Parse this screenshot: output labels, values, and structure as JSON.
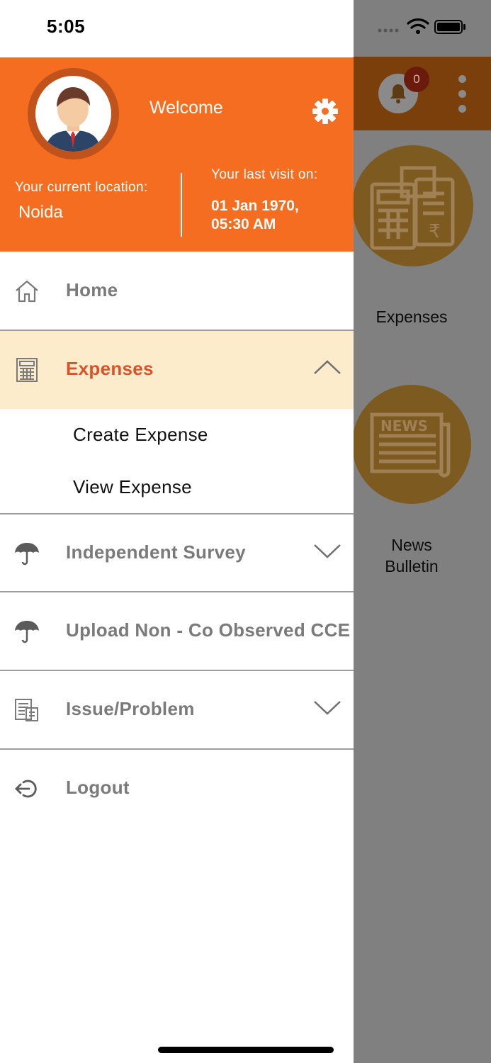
{
  "status_bar": {
    "time": "5:05"
  },
  "background_screen": {
    "notification_count": "0",
    "tiles": [
      {
        "label": "Expenses"
      },
      {
        "label": "News\nBulletin",
        "icon_text": "NEWS"
      }
    ]
  },
  "drawer": {
    "header": {
      "welcome": "Welcome",
      "location_label": "Your current location:",
      "location_value": "Noida",
      "last_visit_label": "Your last visit on:",
      "last_visit_value": "01 Jan 1970,\n05:30 AM"
    },
    "menu": [
      {
        "label": "Home",
        "icon": "home-icon"
      },
      {
        "label": "Expenses",
        "icon": "calculator-icon",
        "expanded": true,
        "sub_items": [
          "Create Expense",
          "View Expense"
        ]
      },
      {
        "label": "Independent Survey",
        "icon": "umbrella-icon"
      },
      {
        "label": "Upload Non - Co Observed CCE",
        "icon": "umbrella-icon"
      },
      {
        "label": "Issue/Problem",
        "icon": "document-icon"
      },
      {
        "label": "Logout",
        "icon": "logout-icon"
      }
    ]
  },
  "colors": {
    "header_orange": "#f46d21",
    "active_bg": "#fdeccb",
    "active_text": "#d9522a",
    "menu_text": "#7a7a7a"
  }
}
